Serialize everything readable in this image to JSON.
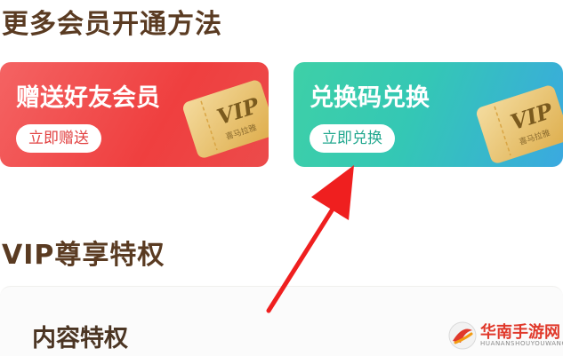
{
  "sections": {
    "more_methods_title": "更多会员开通方法",
    "vip_privileges_title": "VIP尊享特权"
  },
  "cards": [
    {
      "title": "赠送好友会员",
      "button": "立即赠送",
      "ticket_brand": "VIP",
      "ticket_sub": "喜马拉雅",
      "gradient": [
        "#f46363",
        "#ec4b4b"
      ],
      "ticket_color": "#e9bf62"
    },
    {
      "title": "兑换码兑换",
      "button": "立即兑换",
      "ticket_brand": "VIP",
      "ticket_sub": "喜马拉雅",
      "gradient": [
        "#3ed0a7",
        "#3aa9e0"
      ],
      "ticket_color": "#e9c266"
    }
  ],
  "content_privilege": {
    "heading": "内容特权"
  },
  "annotation_arrow": {
    "color": "#ef1f1f"
  },
  "watermark": {
    "name": "华南手游网",
    "domain": "HUANANSHOUYOUWANG"
  }
}
